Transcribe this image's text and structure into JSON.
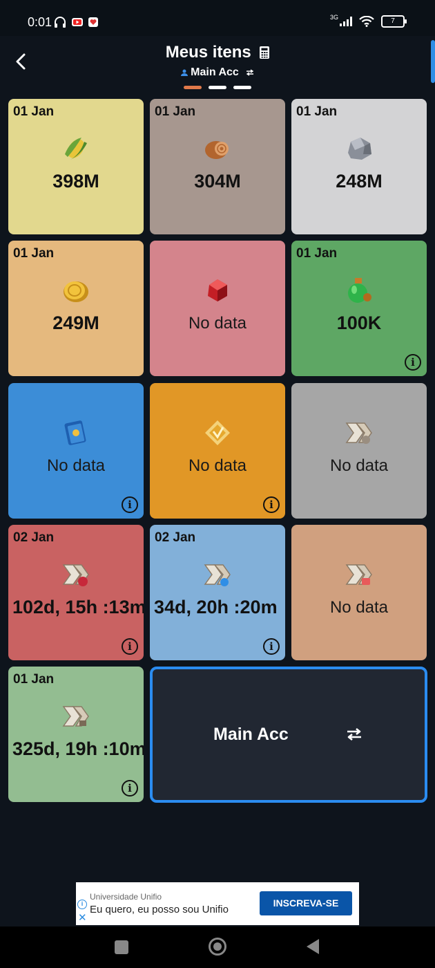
{
  "status_bar": {
    "time": "0:01",
    "network": "3G",
    "battery": "7"
  },
  "header": {
    "title": "Meus itens",
    "account": "Main Acc"
  },
  "tiles": [
    {
      "date": "01 Jan",
      "value": "398M",
      "color": "#e2d88e",
      "icon": "corn-icon"
    },
    {
      "date": "01 Jan",
      "value": "304M",
      "color": "#a7978f",
      "icon": "wood-log-icon"
    },
    {
      "date": "01 Jan",
      "value": "248M",
      "color": "#d3d3d5",
      "icon": "stone-icon"
    },
    {
      "date": "01 Jan",
      "value": "249M",
      "color": "#e5b97e",
      "icon": "gold-coin-icon"
    },
    {
      "date": "",
      "value": "No data",
      "color": "#d4848c",
      "icon": "red-gem-icon"
    },
    {
      "date": "01 Jan",
      "value": "100K",
      "color": "#5ea764",
      "icon": "green-potion-icon"
    },
    {
      "date": "",
      "value": "No data",
      "color": "#3c8dd7",
      "icon": "blue-book-icon"
    },
    {
      "date": "",
      "value": "No data",
      "color": "#e19726",
      "icon": "gold-badge-icon"
    },
    {
      "date": "",
      "value": "No data",
      "color": "#a6a6a6",
      "icon": "speedup-icon"
    },
    {
      "date": "02 Jan",
      "value": "102d, 15h :13m",
      "color": "#c96262",
      "icon": "speedup-troop-icon"
    },
    {
      "date": "02 Jan",
      "value": "34d, 20h :20m",
      "color": "#82b0d9",
      "icon": "speedup-research-icon"
    },
    {
      "date": "",
      "value": "No data",
      "color": "#d0a07f",
      "icon": "speedup-healing-icon"
    },
    {
      "date": "01 Jan",
      "value": "325d, 19h :10m",
      "color": "#93bd91",
      "icon": "speedup-build-icon"
    }
  ],
  "account_tile": {
    "label": "Main Acc"
  },
  "ad": {
    "advertiser": "Universidade Unifio",
    "text": "Eu quero, eu posso sou Unifio",
    "button": "INSCREVA-SE"
  }
}
